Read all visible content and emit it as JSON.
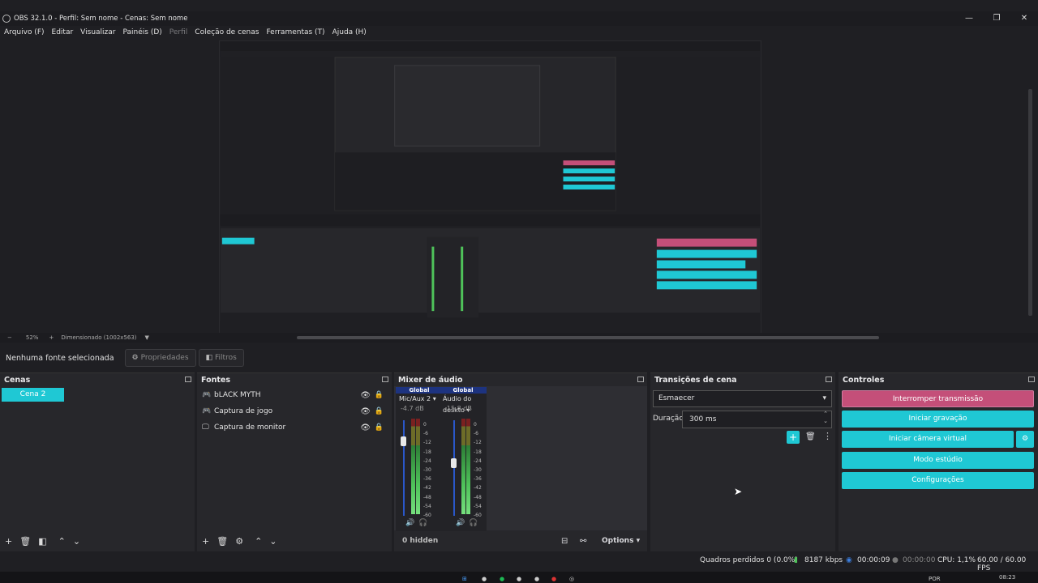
{
  "window": {
    "title": "OBS 32.1.0 - Perfil: Sem nome - Cenas: Sem nome"
  },
  "menu": [
    "Arquivo (F)",
    "Editar",
    "Visualizar",
    "Painéis (D)",
    "Perfil",
    "Coleção de cenas",
    "Ferramentas (T)",
    "Ajuda (H)"
  ],
  "zoombar": {
    "minus": "−",
    "zoom": "52%",
    "plus": "+",
    "scale": "Dimensionado (1002x563)"
  },
  "sourcebar": {
    "nosource": "Nenhuma fonte selecionada",
    "properties": "Propriedades",
    "filters": "Filtros"
  },
  "scenes": {
    "title": "Cenas",
    "items": [
      "Cena 2"
    ]
  },
  "sources": {
    "title": "Fontes",
    "items": [
      {
        "label": "bLACK MYTH",
        "icon": "gamepad-icon"
      },
      {
        "label": "Captura de jogo",
        "icon": "gamepad-icon"
      },
      {
        "label": "Captura de monitor",
        "icon": "monitor-icon"
      }
    ]
  },
  "mixer": {
    "title": "Mixer de áudio",
    "channels": [
      {
        "global": "Global",
        "name": "Mic/Aux 2",
        "db": "-4.7 dB"
      },
      {
        "global": "Global",
        "name": "Áudio do deskto",
        "db": "-15.8 dB"
      }
    ],
    "ticks": [
      "0",
      "-6",
      "-12",
      "-18",
      "-24",
      "-30",
      "-36",
      "-42",
      "-48",
      "-54",
      "-60"
    ],
    "hidden": "0 hidden",
    "options": "Options"
  },
  "transitions": {
    "title": "Transições de cena",
    "selected": "Esmaecer",
    "duration_label": "Duração",
    "duration_value": "300 ms"
  },
  "controls": {
    "title": "Controles",
    "stop_stream": "Interromper transmissão",
    "start_record": "Iniciar gravação",
    "start_vcam": "Iniciar câmera virtual",
    "studio": "Modo estúdio",
    "settings": "Configurações"
  },
  "status": {
    "dropped": "Quadros perdidos 0 (0.0%)",
    "bitrate": "8187 kbps",
    "stream_time": "00:00:09",
    "rec_time": "00:00:00",
    "cpu": "CPU: 1,1%",
    "fps": "60.00 / 60.00 FPS"
  },
  "taskbar": {
    "lang": "POR",
    "time": "08:23"
  },
  "colors": {
    "accent": "#1fc8d4",
    "stream": "#c44f79",
    "background": "#1f1f23",
    "dock": "#27272b"
  }
}
